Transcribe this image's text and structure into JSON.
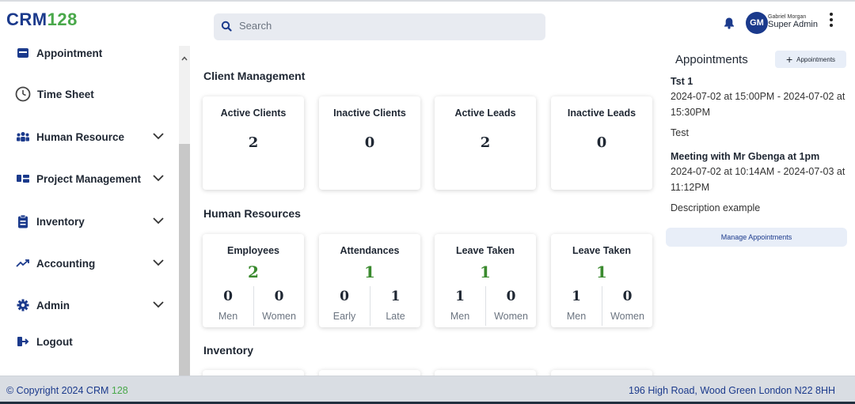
{
  "brand": {
    "logo_part1": "CRM",
    "logo_part2": "128"
  },
  "header": {
    "search_placeholder": "Search",
    "user_name": "Gabriel Morgan",
    "user_role": "Super Admin",
    "avatar_initials": "GM"
  },
  "sidebar": {
    "items": [
      {
        "label": "Appointment",
        "icon": "calendar-icon"
      },
      {
        "label": "Time Sheet",
        "icon": "clock-icon"
      },
      {
        "label": "Human Resource",
        "icon": "people-icon",
        "expandable": true
      },
      {
        "label": "Project Management",
        "icon": "kanban-icon",
        "expandable": true
      },
      {
        "label": "Inventory",
        "icon": "clipboard-icon",
        "expandable": true
      },
      {
        "label": "Accounting",
        "icon": "trend-icon",
        "expandable": true
      },
      {
        "label": "Admin",
        "icon": "gear-icon",
        "expandable": true
      },
      {
        "label": "Logout",
        "icon": "logout-icon"
      }
    ]
  },
  "main": {
    "client_section": "Client Management",
    "client_cards": [
      {
        "title": "Active Clients",
        "value": "2"
      },
      {
        "title": "Inactive Clients",
        "value": "0"
      },
      {
        "title": "Active Leads",
        "value": "2"
      },
      {
        "title": "Inactive Leads",
        "value": "0"
      }
    ],
    "hr_section": "Human Resources",
    "hr_cards": [
      {
        "title": "Employees",
        "value": "2",
        "left_value": "0",
        "left_label": "Men",
        "right_value": "0",
        "right_label": "Women"
      },
      {
        "title": "Attendances",
        "value": "1",
        "left_value": "0",
        "left_label": "Early",
        "right_value": "1",
        "right_label": "Late"
      },
      {
        "title": "Leave Taken",
        "value": "1",
        "left_value": "1",
        "left_label": "Men",
        "right_value": "0",
        "right_label": "Women"
      },
      {
        "title": "Leave Taken",
        "value": "1",
        "left_value": "1",
        "left_label": "Men",
        "right_value": "0",
        "right_label": "Women"
      }
    ],
    "inventory_section": "Inventory"
  },
  "appointments": {
    "title": "Appointments",
    "add_label": "Appointments",
    "items": [
      {
        "title": "Tst 1",
        "dates": "2024-07-02 at 15:00PM - 2024-07-02 at 15:30PM",
        "description": "Test"
      },
      {
        "title": "Meeting with Mr Gbenga at 1pm",
        "dates": "2024-07-02 at 10:14AM - 2024-07-03 at 11:12PM",
        "description": "Description example"
      }
    ],
    "manage_label": "Manage Appointments"
  },
  "footer": {
    "copyright": "© Copyright 2024 CRM",
    "copyright_num": "128",
    "address": "196 High Road, Wood Green London N22 8HH"
  },
  "colors": {
    "brand_blue": "#1b3a8c",
    "brand_green": "#49a84a",
    "value_green": "#3a8a2e"
  }
}
